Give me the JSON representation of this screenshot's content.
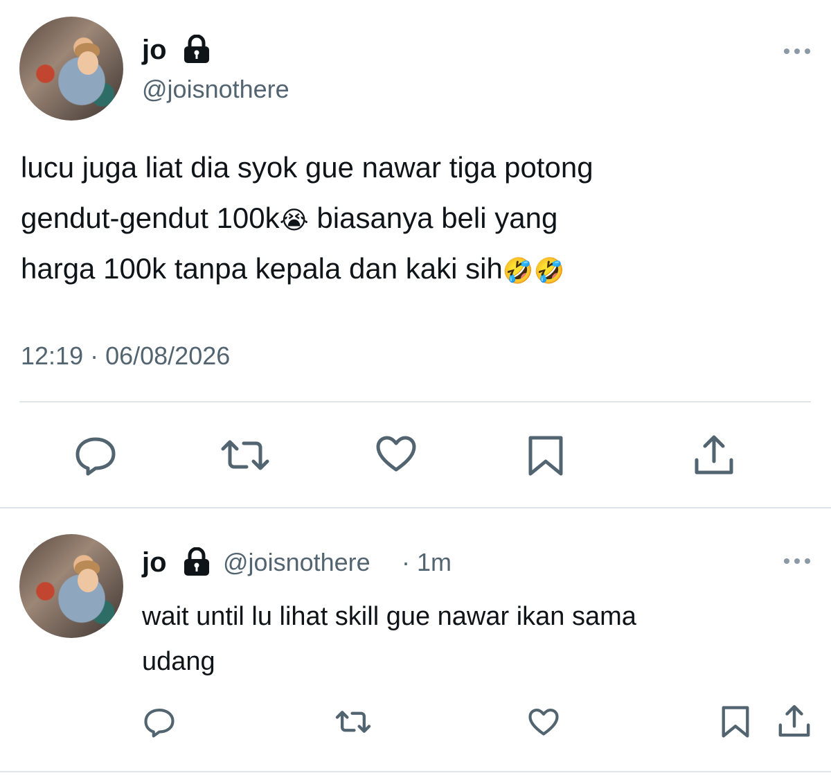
{
  "tweet": {
    "author_name": "jo",
    "author_handle": "@joisnothere",
    "text_lines": [
      "lucu juga liat dia syok gue nawar tiga potong",
      "gendut-gendut 100k",
      " biasanya beli yang",
      "harga 100k tanpa kepala dan kaki sih"
    ],
    "emoji_cry": "😭",
    "emoji_rofl": "🤣🤣",
    "timestamp": "12:19 · 06/08/2026",
    "actions": [
      "reply-icon",
      "retweet-icon",
      "like-icon",
      "bookmark-icon",
      "share-icon"
    ]
  },
  "reply": {
    "author_name": "jo",
    "author_handle": "@joisnothere",
    "time_ago": "· 1m",
    "text_lines": [
      "wait until lu lihat skill gue nawar ikan sama",
      "udang"
    ],
    "actions": [
      "reply-icon",
      "retweet-icon",
      "like-icon",
      "bookmark-icon",
      "share-icon"
    ]
  },
  "icon_color": "#536471",
  "divider_color": "#e1e6ea"
}
